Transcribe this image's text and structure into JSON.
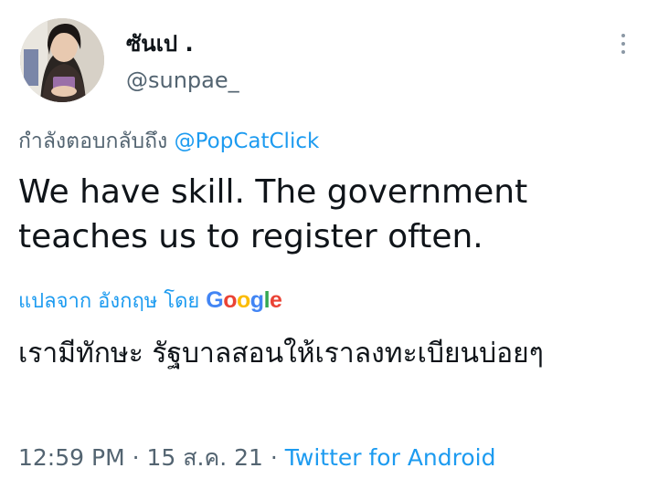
{
  "author": {
    "display_name": "ซันเป .",
    "handle": "@sunpae_"
  },
  "reply": {
    "prefix": "กำลังตอบกลับถึง",
    "target": "@PopCatClick"
  },
  "tweet_text": "We have skill. The government teaches us to register often.",
  "translation": {
    "label": "แปลจาก อังกฤษ โดย",
    "provider_logo": "Google",
    "text": "เรามีทักษะ รัฐบาลสอนให้เราลงทะเบียนบ่อยๆ"
  },
  "meta": {
    "time": "12:59 PM",
    "separator": "·",
    "date": "15 ส.ค. 21",
    "source": "Twitter for Android"
  },
  "icons": {
    "more": "more-vertical-icon"
  },
  "colors": {
    "link": "#1d9bf0",
    "secondary_text": "#536471"
  }
}
